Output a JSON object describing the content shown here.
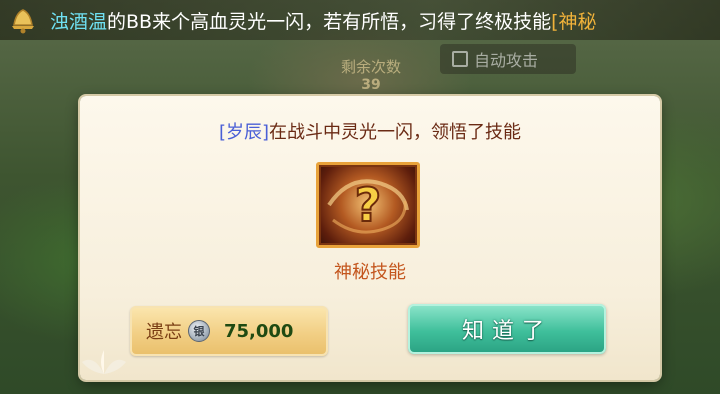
{
  "banner": {
    "icon": "bell-icon",
    "player_name": "浊酒温",
    "text_part1": "的BB来个高血",
    "text_part2": "灵光一闪，若有所悟，习得了终极技能",
    "skill_partial": "[神秘"
  },
  "hud": {
    "auto_attack_label": "自动攻击",
    "bg_label": "剩余次数",
    "bg_value": "39"
  },
  "dialog": {
    "who": "[岁辰]",
    "message": "在战斗中灵光一闪，领悟了技能",
    "skill_icon": "mystery-skill-icon",
    "skill_name": "神秘技能",
    "forget_label": "遗忘",
    "currency_icon": "silver-coin-icon",
    "currency_glyph": "银",
    "forget_cost": "75,000",
    "confirm_label": "知道了"
  },
  "colors": {
    "player_name": "#6fe0f2",
    "skill_highlight": "#f0b23a",
    "message_text": "#6a2a14",
    "pet_name": "#4a5fd6",
    "skill_name": "#c4561e",
    "confirm_button": "#3fbf9b",
    "forget_button": "#f2cf85"
  }
}
